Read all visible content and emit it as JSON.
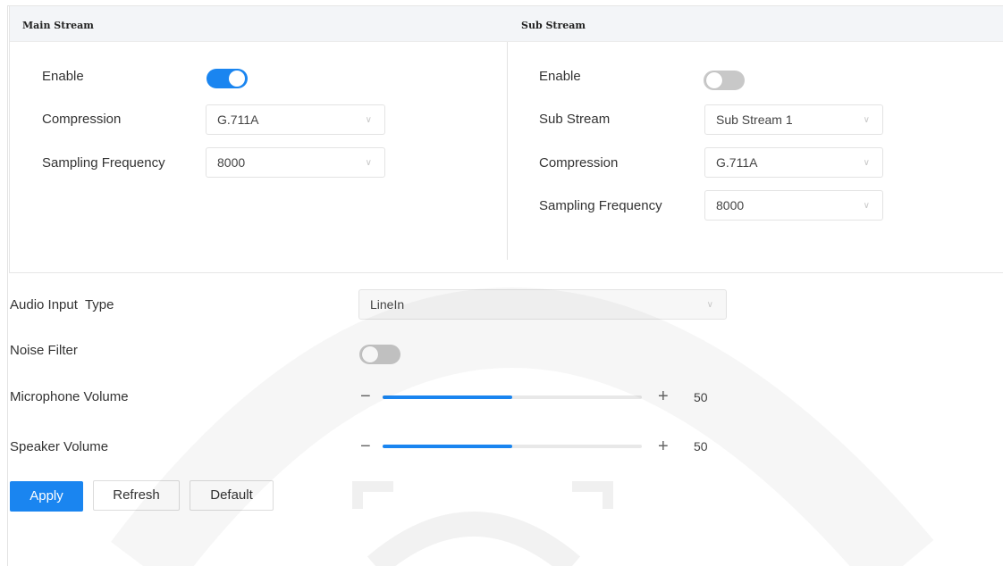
{
  "main_stream": {
    "title": "Main Stream",
    "enable_label": "Enable",
    "enable_on": true,
    "compression_label": "Compression",
    "compression_value": "G.711A",
    "sampling_label": "Sampling Frequency",
    "sampling_value": "8000"
  },
  "sub_stream": {
    "title": "Sub Stream",
    "enable_label": "Enable",
    "enable_on": false,
    "substream_label": "Sub Stream",
    "substream_value": "Sub Stream 1",
    "compression_label": "Compression",
    "compression_value": "G.711A",
    "sampling_label": "Sampling Frequency",
    "sampling_value": "8000"
  },
  "audio_input": {
    "label": "Audio Input  Type",
    "value": "LineIn"
  },
  "noise_filter": {
    "label": "Noise Filter",
    "on": false
  },
  "microphone_volume": {
    "label": "Microphone Volume",
    "minus": "−",
    "plus": "+",
    "value": "50"
  },
  "speaker_volume": {
    "label": "Speaker Volume",
    "minus": "−",
    "plus": "+",
    "value": "50"
  },
  "buttons": {
    "apply": "Apply",
    "refresh": "Refresh",
    "default": "Default"
  },
  "icons": {
    "dropdown": "chevron-down-icon"
  },
  "colors": {
    "accent": "#1a85f0",
    "toggle_off": "#c8c8c8",
    "header_bg": "#f3f5f8"
  }
}
